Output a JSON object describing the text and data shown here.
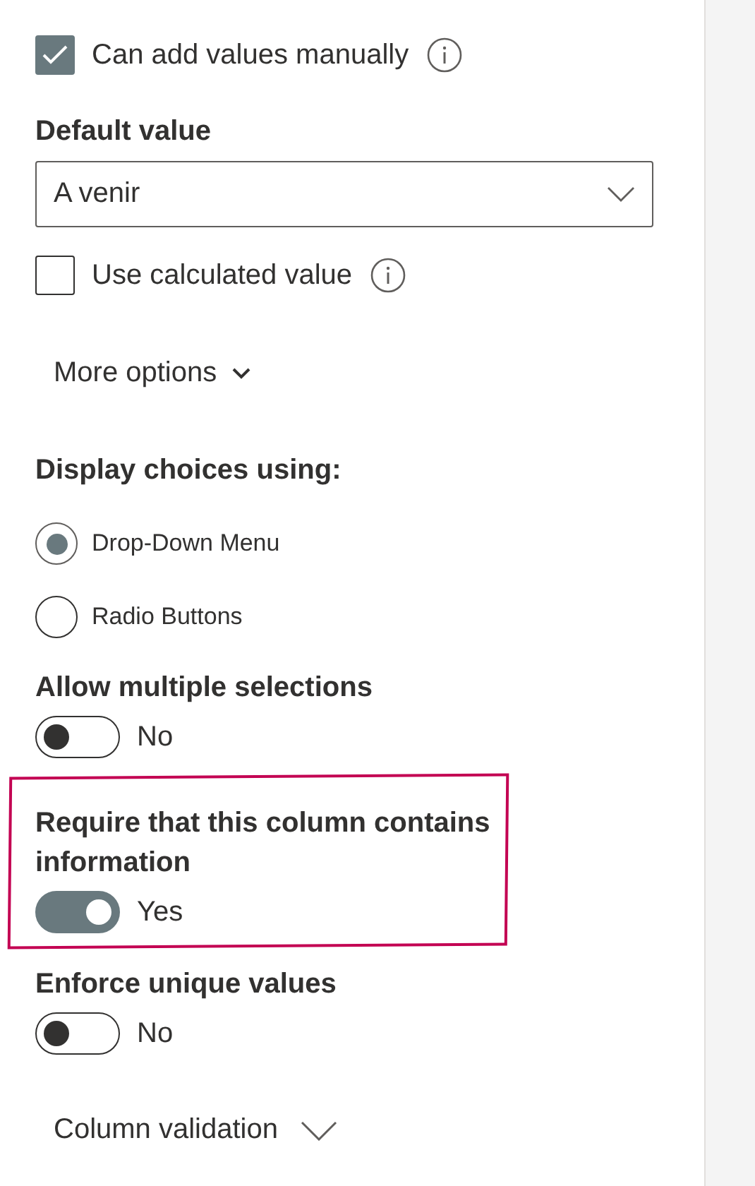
{
  "manual_values": {
    "label": "Can add values manually",
    "checked": true
  },
  "default_value": {
    "label": "Default value",
    "value": "A venir"
  },
  "calculated_value": {
    "label": "Use calculated value",
    "checked": false
  },
  "more_options": {
    "label": "More options"
  },
  "display_choices": {
    "label": "Display choices using:",
    "options": [
      {
        "label": "Drop-Down Menu",
        "selected": true
      },
      {
        "label": "Radio Buttons",
        "selected": false
      }
    ]
  },
  "toggles": [
    {
      "label": "Allow multiple selections",
      "on": false,
      "state_text": "No",
      "highlighted": false
    },
    {
      "label": "Require that this column contains information",
      "on": true,
      "state_text": "Yes",
      "highlighted": true
    },
    {
      "label": "Enforce unique values",
      "on": false,
      "state_text": "No",
      "highlighted": false
    }
  ],
  "column_validation": {
    "label": "Column validation"
  }
}
